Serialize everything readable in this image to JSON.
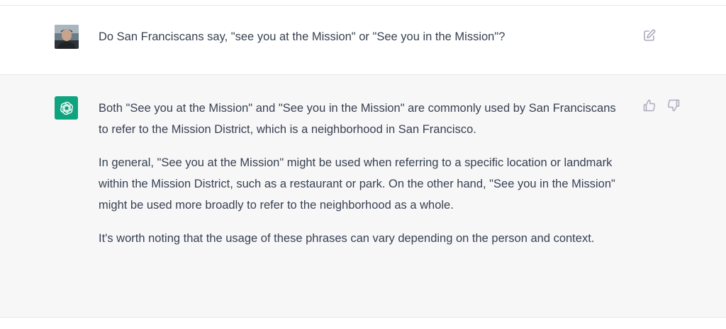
{
  "user_message": {
    "avatar_icon": "user-avatar-photo",
    "text": "Do San Franciscans say, \"see you at the Mission\" or \"See you in the Mission\"?",
    "action_icon": "edit-icon"
  },
  "assistant_message": {
    "logo_icon": "openai-logo-icon",
    "logo_color": "#10a37f",
    "paragraphs": [
      "Both \"See you at the Mission\" and \"See you in the Mission\" are commonly used by San Franciscans to refer to the Mission District, which is a neighborhood in San Francisco.",
      "In general, \"See you at the Mission\" might be used when referring to a specific location or landmark within the Mission District, such as a restaurant or park. On the other hand, \"See you in the Mission\" might be used more broadly to refer to the neighborhood as a whole.",
      "It's worth noting that the usage of these phrases can vary depending on the person and context."
    ],
    "feedback_icons": [
      "thumbs-up-icon",
      "thumbs-down-icon"
    ]
  },
  "colors": {
    "assistant_background": "#f7f7f8",
    "text": "#374151",
    "icon": "#acacbe"
  }
}
